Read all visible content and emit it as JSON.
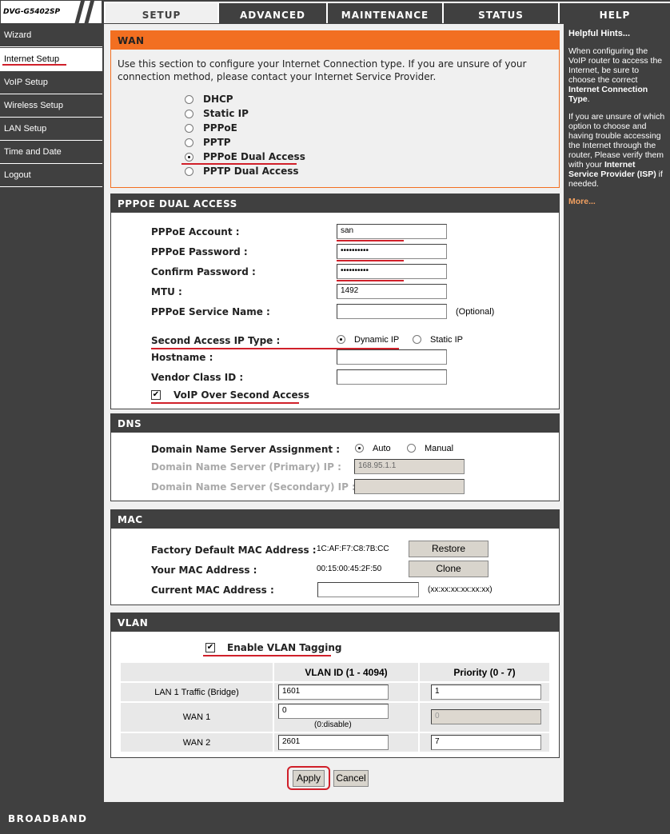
{
  "model": "DVG-G5402SP",
  "tabs": [
    "SETUP",
    "ADVANCED",
    "MAINTENANCE",
    "STATUS",
    "HELP"
  ],
  "sidebar": [
    "Wizard",
    "Internet Setup",
    "VoIP Setup",
    "Wireless Setup",
    "LAN Setup",
    "Time and Date",
    "Logout"
  ],
  "wan": {
    "title": "WAN",
    "desc": "Use this section to configure your Internet Connection type. If you are unsure of your connection method, please contact your Internet Service Provider.",
    "options": [
      "DHCP",
      "Static IP",
      "PPPoE",
      "PPTP",
      "PPPoE Dual Access",
      "PPTP Dual Access"
    ],
    "selected": "PPPoE Dual Access"
  },
  "pppoe": {
    "title": "PPPOE DUAL ACCESS",
    "account_label": "PPPoE Account :",
    "account": "san",
    "password_label": "PPPoE Password :",
    "password": "••••••••••",
    "confirm_label": "Confirm Password :",
    "confirm": "••••••••••",
    "mtu_label": "MTU :",
    "mtu": "1492",
    "service_label": "PPPoE Service Name :",
    "service": "",
    "optional": "(Optional)",
    "second_label": "Second Access IP Type :",
    "dynamic": "Dynamic IP",
    "static": "Static IP",
    "second_selected": "Dynamic IP",
    "hostname_label": "Hostname :",
    "hostname": "",
    "vendor_label": "Vendor Class ID :",
    "vendor": "",
    "voip_label": "VoIP Over Second Access",
    "voip_checked": true
  },
  "dns": {
    "title": "DNS",
    "assign_label": "Domain Name Server Assignment :",
    "auto": "Auto",
    "manual": "Manual",
    "selected": "Auto",
    "primary_label": "Domain Name Server (Primary) IP :",
    "primary": "168.95.1.1",
    "secondary_label": "Domain Name Server (Secondary) IP :",
    "secondary": ""
  },
  "mac": {
    "title": "MAC",
    "factory_label": "Factory Default MAC Address :",
    "factory": "1C:AF:F7:C8:7B:CC",
    "restore": "Restore",
    "your_label": "Your MAC Address :",
    "your": "00:15:00:45:2F:50",
    "clone": "Clone",
    "current_label": "Current MAC Address :",
    "current": "",
    "format": "(xx:xx:xx:xx:xx:xx)"
  },
  "vlan": {
    "title": "VLAN",
    "enable_label": "Enable VLAN Tagging",
    "enabled": true,
    "col_id": "VLAN ID (1 - 4094)",
    "col_priority": "Priority (0 - 7)",
    "rows": [
      {
        "name": "LAN 1 Traffic (Bridge)",
        "id": "1601",
        "priority": "1"
      },
      {
        "name": "WAN 1",
        "id": "0",
        "note": "(0:disable)",
        "priority": "0"
      },
      {
        "name": "WAN 2",
        "id": "2601",
        "priority": "7"
      }
    ]
  },
  "buttons": {
    "apply": "Apply",
    "cancel": "Cancel"
  },
  "help": {
    "title": "Helpful Hints...",
    "p1a": "When configuring the VoIP router to access the Internet, be sure to choose the correct ",
    "p1b": "Internet Connection Type",
    "p1c": ".",
    "p2a": "If you are unsure of which option to choose and having trouble accessing the Internet through the router, Please verify them with your ",
    "p2b": "Internet Service Provider (ISP)",
    "p2c": " if needed.",
    "more": "More..."
  },
  "footer": "BROADBAND",
  "colors": {
    "accent": "#f26f21",
    "dark": "#404040",
    "annotation": "#d0202a"
  }
}
